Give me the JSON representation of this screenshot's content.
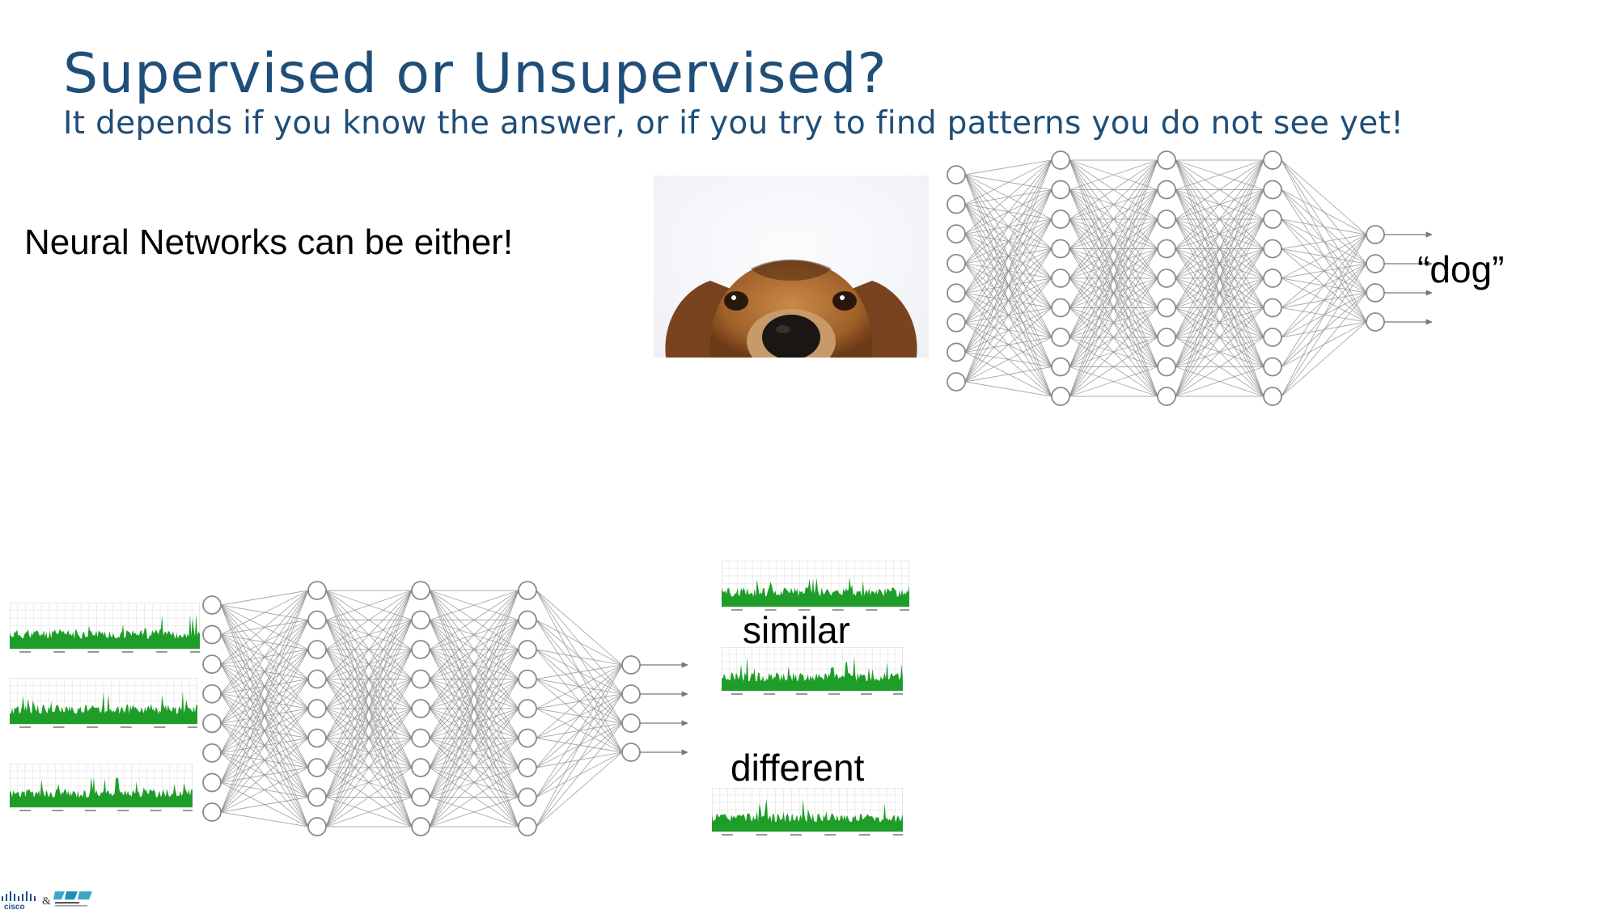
{
  "slide": {
    "title": "Supervised or Unsupervised?",
    "subtitle": "It depends if you know the answer, or if you try to find patterns you do not see yet!",
    "lead": "Neural Networks can be either!"
  },
  "supervised": {
    "output_label": "“dog”",
    "image": "dog-photo"
  },
  "unsupervised": {
    "similar_label": "similar",
    "different_label": "different"
  },
  "footer": {
    "brand": "cisco",
    "ampersand": "&"
  },
  "colors": {
    "title": "#1f4e79",
    "chart_fill": "#1e9e28",
    "node_stroke": "#8a8a8a"
  }
}
